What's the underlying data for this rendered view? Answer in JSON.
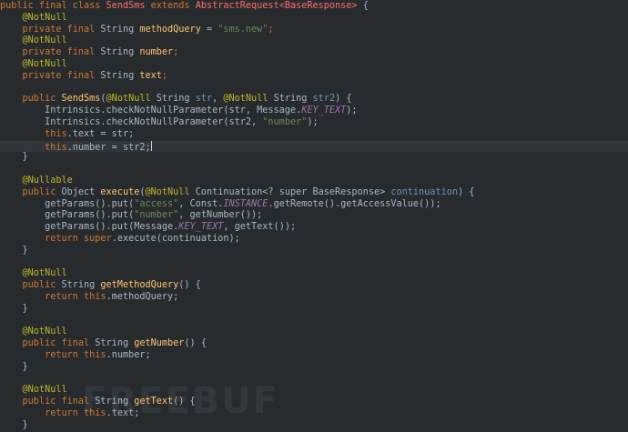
{
  "editor": {
    "lines": [
      [
        {
          "t": "public final class ",
          "c": "kw"
        },
        {
          "t": "SendSms",
          "c": "cls"
        },
        {
          "t": " extends ",
          "c": "kw"
        },
        {
          "t": "AbstractRequest<BaseResponse>",
          "c": "cls"
        },
        {
          "t": " {",
          "c": "plain"
        }
      ],
      [
        {
          "t": "    @NotNull",
          "c": "ann"
        }
      ],
      [
        {
          "t": "    private final ",
          "c": "kw"
        },
        {
          "t": "String ",
          "c": "plain"
        },
        {
          "t": "methodQuery",
          "c": "fn"
        },
        {
          "t": " = ",
          "c": "plain"
        },
        {
          "t": "\"sms.new\"",
          "c": "str"
        },
        {
          "t": ";",
          "c": "kw"
        }
      ],
      [
        {
          "t": "    @NotNull",
          "c": "ann"
        }
      ],
      [
        {
          "t": "    private final ",
          "c": "kw"
        },
        {
          "t": "String ",
          "c": "plain"
        },
        {
          "t": "number",
          "c": "fn"
        },
        {
          "t": ";",
          "c": "kw"
        }
      ],
      [
        {
          "t": "    @NotNull",
          "c": "ann"
        }
      ],
      [
        {
          "t": "    private final ",
          "c": "kw"
        },
        {
          "t": "String ",
          "c": "plain"
        },
        {
          "t": "text",
          "c": "fn"
        },
        {
          "t": ";",
          "c": "kw"
        }
      ],
      [],
      [
        {
          "t": "    public ",
          "c": "kw"
        },
        {
          "t": "SendSms",
          "c": "fn"
        },
        {
          "t": "(",
          "c": "plain"
        },
        {
          "t": "@NotNull",
          "c": "ann"
        },
        {
          "t": " String ",
          "c": "plain"
        },
        {
          "t": "str",
          "c": "param"
        },
        {
          "t": ", ",
          "c": "plain"
        },
        {
          "t": "@NotNull",
          "c": "ann"
        },
        {
          "t": " String ",
          "c": "plain"
        },
        {
          "t": "str2",
          "c": "param"
        },
        {
          "t": ") {",
          "c": "plain"
        }
      ],
      [
        {
          "t": "        Intrinsics.checkNotNullParameter(str, Message.",
          "c": "plain"
        },
        {
          "t": "KEY_TEXT",
          "c": "cst"
        },
        {
          "t": ");",
          "c": "plain"
        }
      ],
      [
        {
          "t": "        Intrinsics.checkNotNullParameter(str2, ",
          "c": "plain"
        },
        {
          "t": "\"number\"",
          "c": "str"
        },
        {
          "t": ");",
          "c": "plain"
        }
      ],
      [
        {
          "t": "        this",
          "c": "kw"
        },
        {
          "t": ".text = str;",
          "c": "plain"
        }
      ],
      [
        {
          "t": "        this",
          "c": "kw"
        },
        {
          "t": ".number = str2;",
          "c": "plain"
        }
      ],
      [
        {
          "t": "    }",
          "c": "plain"
        }
      ],
      [],
      [
        {
          "t": "    @Nullable",
          "c": "ann"
        }
      ],
      [
        {
          "t": "    public ",
          "c": "kw"
        },
        {
          "t": "Object ",
          "c": "plain"
        },
        {
          "t": "execute",
          "c": "fn"
        },
        {
          "t": "(",
          "c": "plain"
        },
        {
          "t": "@NotNull",
          "c": "ann"
        },
        {
          "t": " Continuation<? super BaseResponse> ",
          "c": "plain"
        },
        {
          "t": "continuation",
          "c": "param"
        },
        {
          "t": ") {",
          "c": "plain"
        }
      ],
      [
        {
          "t": "        getParams().put(",
          "c": "plain"
        },
        {
          "t": "\"access\"",
          "c": "str"
        },
        {
          "t": ", Const.",
          "c": "plain"
        },
        {
          "t": "INSTANCE",
          "c": "cst"
        },
        {
          "t": ".getRemote().getAccessValue());",
          "c": "plain"
        }
      ],
      [
        {
          "t": "        getParams().put(",
          "c": "plain"
        },
        {
          "t": "\"number\"",
          "c": "str"
        },
        {
          "t": ", getNumber());",
          "c": "plain"
        }
      ],
      [
        {
          "t": "        getParams().put(Message.",
          "c": "plain"
        },
        {
          "t": "KEY_TEXT",
          "c": "cst"
        },
        {
          "t": ", getText());",
          "c": "plain"
        }
      ],
      [
        {
          "t": "        return ",
          "c": "kw"
        },
        {
          "t": "super",
          "c": "kw"
        },
        {
          "t": ".execute(continuation);",
          "c": "plain"
        }
      ],
      [
        {
          "t": "    }",
          "c": "plain"
        }
      ],
      [],
      [
        {
          "t": "    @NotNull",
          "c": "ann"
        }
      ],
      [
        {
          "t": "    public ",
          "c": "kw"
        },
        {
          "t": "String ",
          "c": "plain"
        },
        {
          "t": "getMethodQuery",
          "c": "fn"
        },
        {
          "t": "() {",
          "c": "plain"
        }
      ],
      [
        {
          "t": "        return ",
          "c": "kw"
        },
        {
          "t": "this",
          "c": "kw"
        },
        {
          "t": ".methodQuery;",
          "c": "plain"
        }
      ],
      [
        {
          "t": "    }",
          "c": "plain"
        }
      ],
      [],
      [
        {
          "t": "    @NotNull",
          "c": "ann"
        }
      ],
      [
        {
          "t": "    public final ",
          "c": "kw"
        },
        {
          "t": "String ",
          "c": "plain"
        },
        {
          "t": "getNumber",
          "c": "fn"
        },
        {
          "t": "() {",
          "c": "plain"
        }
      ],
      [
        {
          "t": "        return ",
          "c": "kw"
        },
        {
          "t": "this",
          "c": "kw"
        },
        {
          "t": ".number;",
          "c": "plain"
        }
      ],
      [
        {
          "t": "    }",
          "c": "plain"
        }
      ],
      [],
      [
        {
          "t": "    @NotNull",
          "c": "ann"
        }
      ],
      [
        {
          "t": "    public final ",
          "c": "kw"
        },
        {
          "t": "String ",
          "c": "plain"
        },
        {
          "t": "getText",
          "c": "fn"
        },
        {
          "t": "() {",
          "c": "plain"
        }
      ],
      [
        {
          "t": "        return ",
          "c": "kw"
        },
        {
          "t": "this",
          "c": "kw"
        },
        {
          "t": ".text;",
          "c": "plain"
        }
      ],
      [
        {
          "t": "    }",
          "c": "plain"
        }
      ]
    ],
    "current_line": 12
  },
  "watermark": "FREEBUF"
}
